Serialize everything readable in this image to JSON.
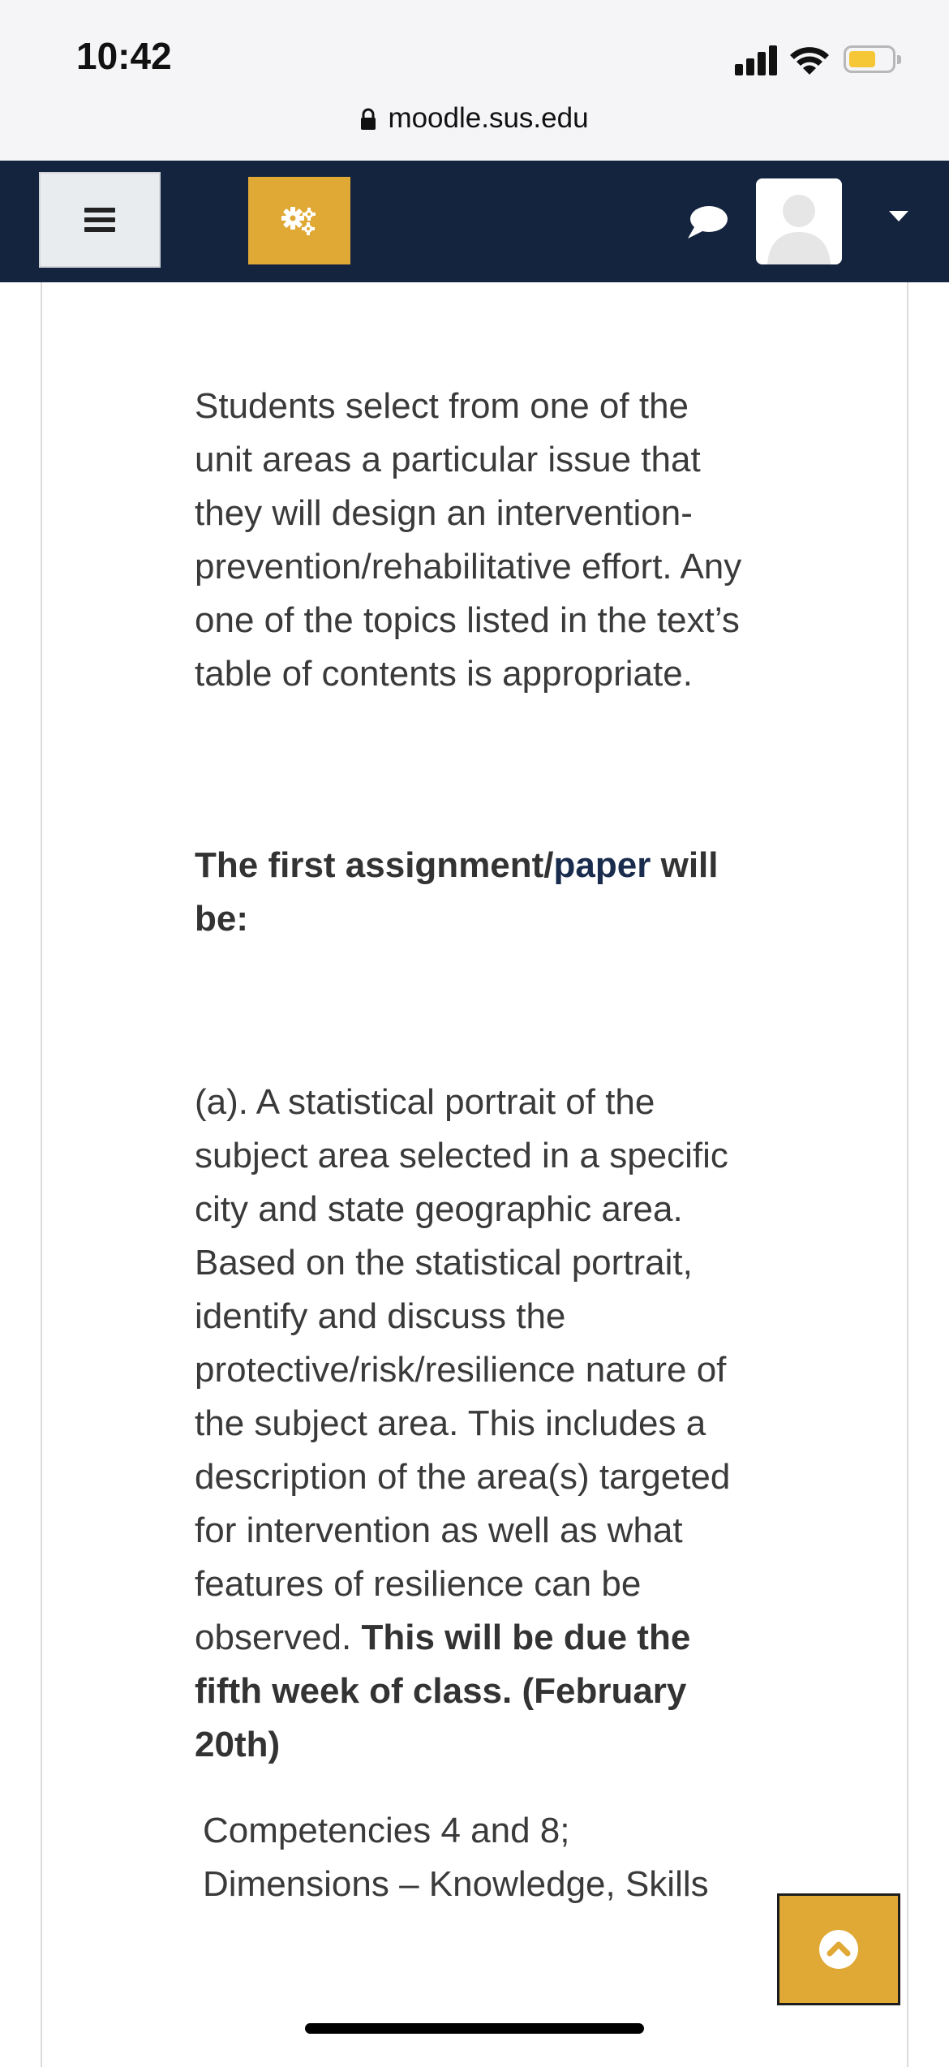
{
  "status_bar": {
    "time": "10:42"
  },
  "address_bar": {
    "url": "moodle.sus.edu"
  },
  "navbar": {
    "menu_icon": "hamburger-icon",
    "settings_icon": "gears-icon",
    "messages_icon": "chat-icon",
    "user_icon": "user-avatar",
    "accent_color": "#e0a935",
    "background_color": "#14243f"
  },
  "content": {
    "paragraph1": "Students select from one of the unit areas a particular issue that they will design an intervention-prevention/rehabilitative effort. Any one of the topics listed in the text’s table of contents is appropriate.",
    "heading_prefix": "The first assignment/",
    "heading_link": "paper",
    "heading_suffix": " will be:",
    "paragraph3_text": "(a). A statistical portrait of the subject area selected in a specific city and state geographic area. Based on the statistical portrait, identify and discuss the protective/risk/resilience nature of the subject area. This includes a description of the area(s) targeted for intervention as well as what features of resilience can be observed. ",
    "paragraph3_bold": "This will be due the fifth week of class. (February 20th)",
    "paragraph4": "Competencies 4 and 8; Dimensions – Knowledge, Skills"
  },
  "back_to_top_icon": "chevron-up-icon"
}
